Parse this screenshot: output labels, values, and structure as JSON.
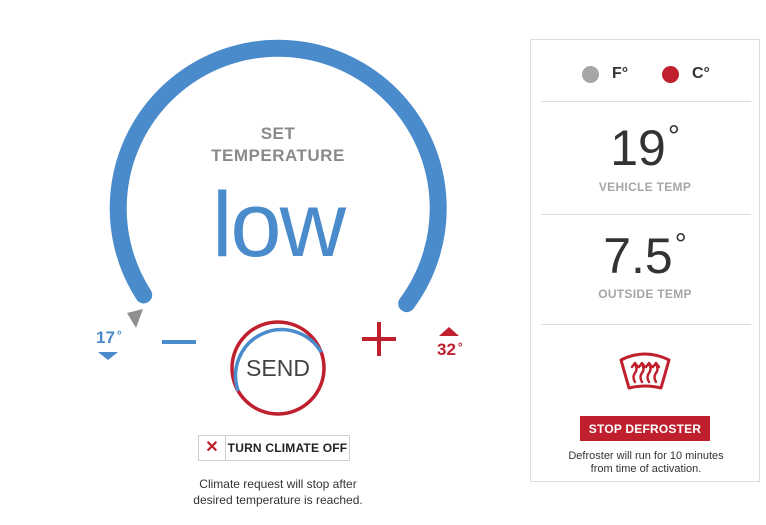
{
  "dial": {
    "set_line1": "SET",
    "set_line2": "TEMPERATURE",
    "value": "low",
    "min": "17",
    "max": "32",
    "degree": "°",
    "arc_color": "#4a8bcb",
    "accent_red": "#c0202e"
  },
  "controls": {
    "decrease_icon": "minus-icon",
    "increase_icon": "plus-icon",
    "send_label": "SEND"
  },
  "climate_off": {
    "icon": "close-icon",
    "label": "TURN CLIMATE OFF",
    "note_line1": "Climate request will stop after",
    "note_line2": "desired temperature is reached."
  },
  "panel": {
    "units": [
      {
        "label": "F°",
        "selected": false,
        "color": "#a6a6a6"
      },
      {
        "label": "C°",
        "selected": true,
        "color": "#c0202e"
      }
    ],
    "vehicle_temp": {
      "value": "19",
      "degree": "°",
      "caption": "VEHICLE TEMP"
    },
    "outside_temp": {
      "value": "7.5",
      "degree": "°",
      "caption": "OUTSIDE TEMP"
    },
    "defroster": {
      "icon": "defroster-icon",
      "button_label": "STOP DEFROSTER",
      "note_line1": "Defroster will run for 10 minutes",
      "note_line2": "from time of activation."
    }
  }
}
